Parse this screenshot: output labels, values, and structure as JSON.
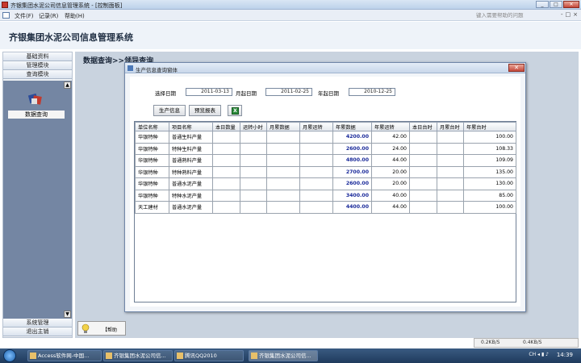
{
  "window": {
    "title": "齐银集团水泥公司信息管理系统 - [控制面板]",
    "btn_min": "_",
    "btn_max": "□",
    "btn_close": "✕"
  },
  "menubar": {
    "items": [
      "文件(F)",
      "记录(R)",
      "帮助(H)"
    ],
    "help_placeholder": "键入需要帮助的问题",
    "mini_btns": [
      "-",
      "□",
      "×"
    ]
  },
  "header": {
    "system_title": "齐银集团水泥公司信息管理系统"
  },
  "sidebar": {
    "items": [
      "基础资料",
      "管理模块",
      "查询模块"
    ],
    "bottom_items": [
      "系统管理",
      "退出主销"
    ],
    "query_label": "数据查询",
    "scroll_up": "▲",
    "scroll_down": "▼"
  },
  "content": {
    "breadcrumb": "数据查询>>领导查询",
    "tip_text": "【帮助"
  },
  "dialog": {
    "title": "生产信息查询窗体",
    "close": "✕",
    "filters": {
      "select_date_label": "选择日期",
      "select_date": "2011-03-13",
      "month_start_label": "月起日期",
      "month_start": "2011-02-25",
      "year_start_label": "年起日期",
      "year_start": "2010-12-25"
    },
    "buttons": {
      "production_info": "生产信息",
      "preview_report": "预览报表",
      "excel": "X"
    },
    "table": {
      "columns": [
        "单位名称",
        "项目名称",
        "本日数量",
        "运转小时",
        "月累数据",
        "月累运转",
        "年累数据",
        "年累运转",
        "本日台时",
        "月累台时",
        "年累台时"
      ],
      "rows": [
        [
          "华银特种",
          "普通生料产量",
          "",
          "",
          "",
          "",
          "4200.00",
          "42.00",
          "",
          "",
          "100.00"
        ],
        [
          "华银特种",
          "特种生料产量",
          "",
          "",
          "",
          "",
          "2600.00",
          "24.00",
          "",
          "",
          "108.33"
        ],
        [
          "华银特种",
          "普通熟料产量",
          "",
          "",
          "",
          "",
          "4800.00",
          "44.00",
          "",
          "",
          "109.09"
        ],
        [
          "华银特种",
          "特种熟料产量",
          "",
          "",
          "",
          "",
          "2700.00",
          "20.00",
          "",
          "",
          "135.00"
        ],
        [
          "华银特种",
          "普通水泥产量",
          "",
          "",
          "",
          "",
          "2600.00",
          "20.00",
          "",
          "",
          "130.00"
        ],
        [
          "华银特种",
          "特种水泥产量",
          "",
          "",
          "",
          "",
          "3400.00",
          "40.00",
          "",
          "",
          "85.00"
        ],
        [
          "天工建材",
          "普通水泥产量",
          "",
          "",
          "",
          "",
          "4400.00",
          "44.00",
          "",
          "",
          "100.00"
        ]
      ]
    }
  },
  "netspeed": {
    "down": "0.2KB/S",
    "up": "0.4KB/S"
  },
  "taskbar": {
    "tasks": [
      "Access软件网-中国...",
      "齐银集团水泥公司信...",
      "腾讯QQ2010",
      "齐银集团水泥公司信..."
    ],
    "tray": "CH ◂ ▮ ♪",
    "clock": "14:39"
  }
}
